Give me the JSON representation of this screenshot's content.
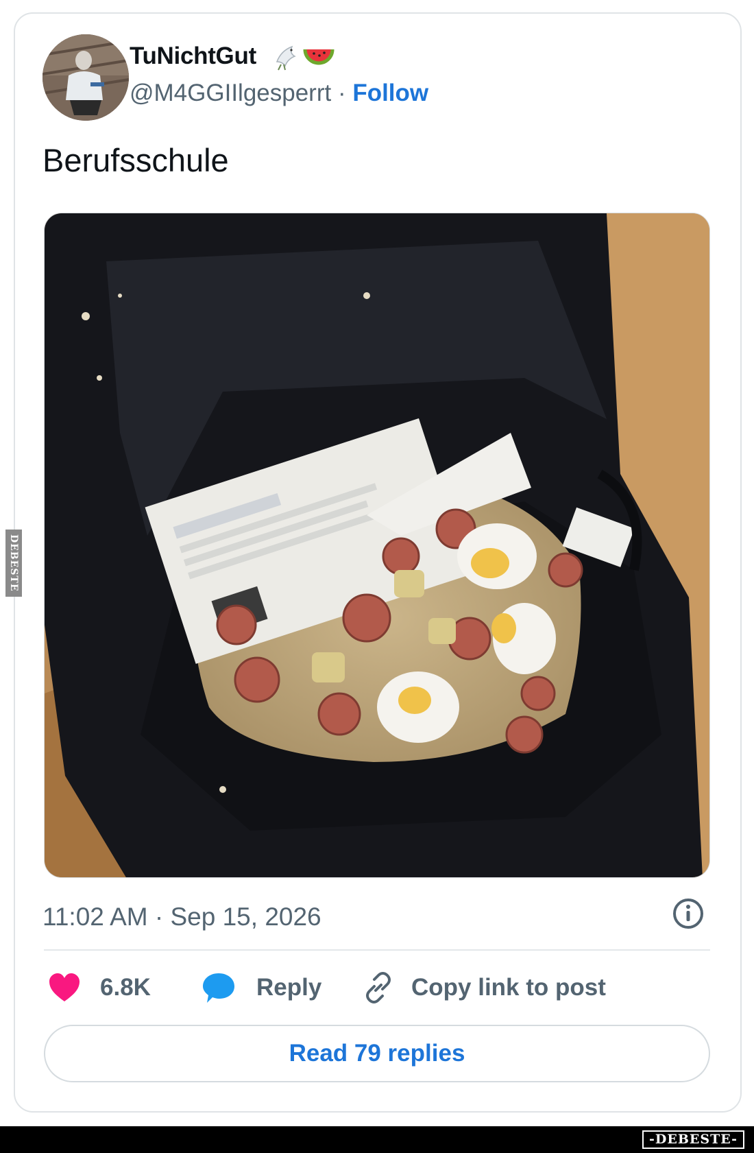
{
  "tweet": {
    "display_name": "TuNichtGut",
    "badges": [
      "dove-icon",
      "watermelon-icon"
    ],
    "handle": "@M4GGIIlgesperrt",
    "separator": " · ",
    "follow_label": "Follow",
    "text": "Berufsschule",
    "time": "11:02 AM",
    "date": "Sep 15, 2026",
    "likes_count": "6.8K",
    "reply_label": "Reply",
    "copy_link_label": "Copy link to post",
    "read_replies_label": "Read 79 replies"
  },
  "colors": {
    "link": "#1d75d8",
    "heart": "#f91880",
    "reply_bubble": "#1d9bf0",
    "secondary_text": "#536471"
  },
  "watermark": {
    "side": "DEBESTE",
    "footer": "-DEBESTE-"
  }
}
